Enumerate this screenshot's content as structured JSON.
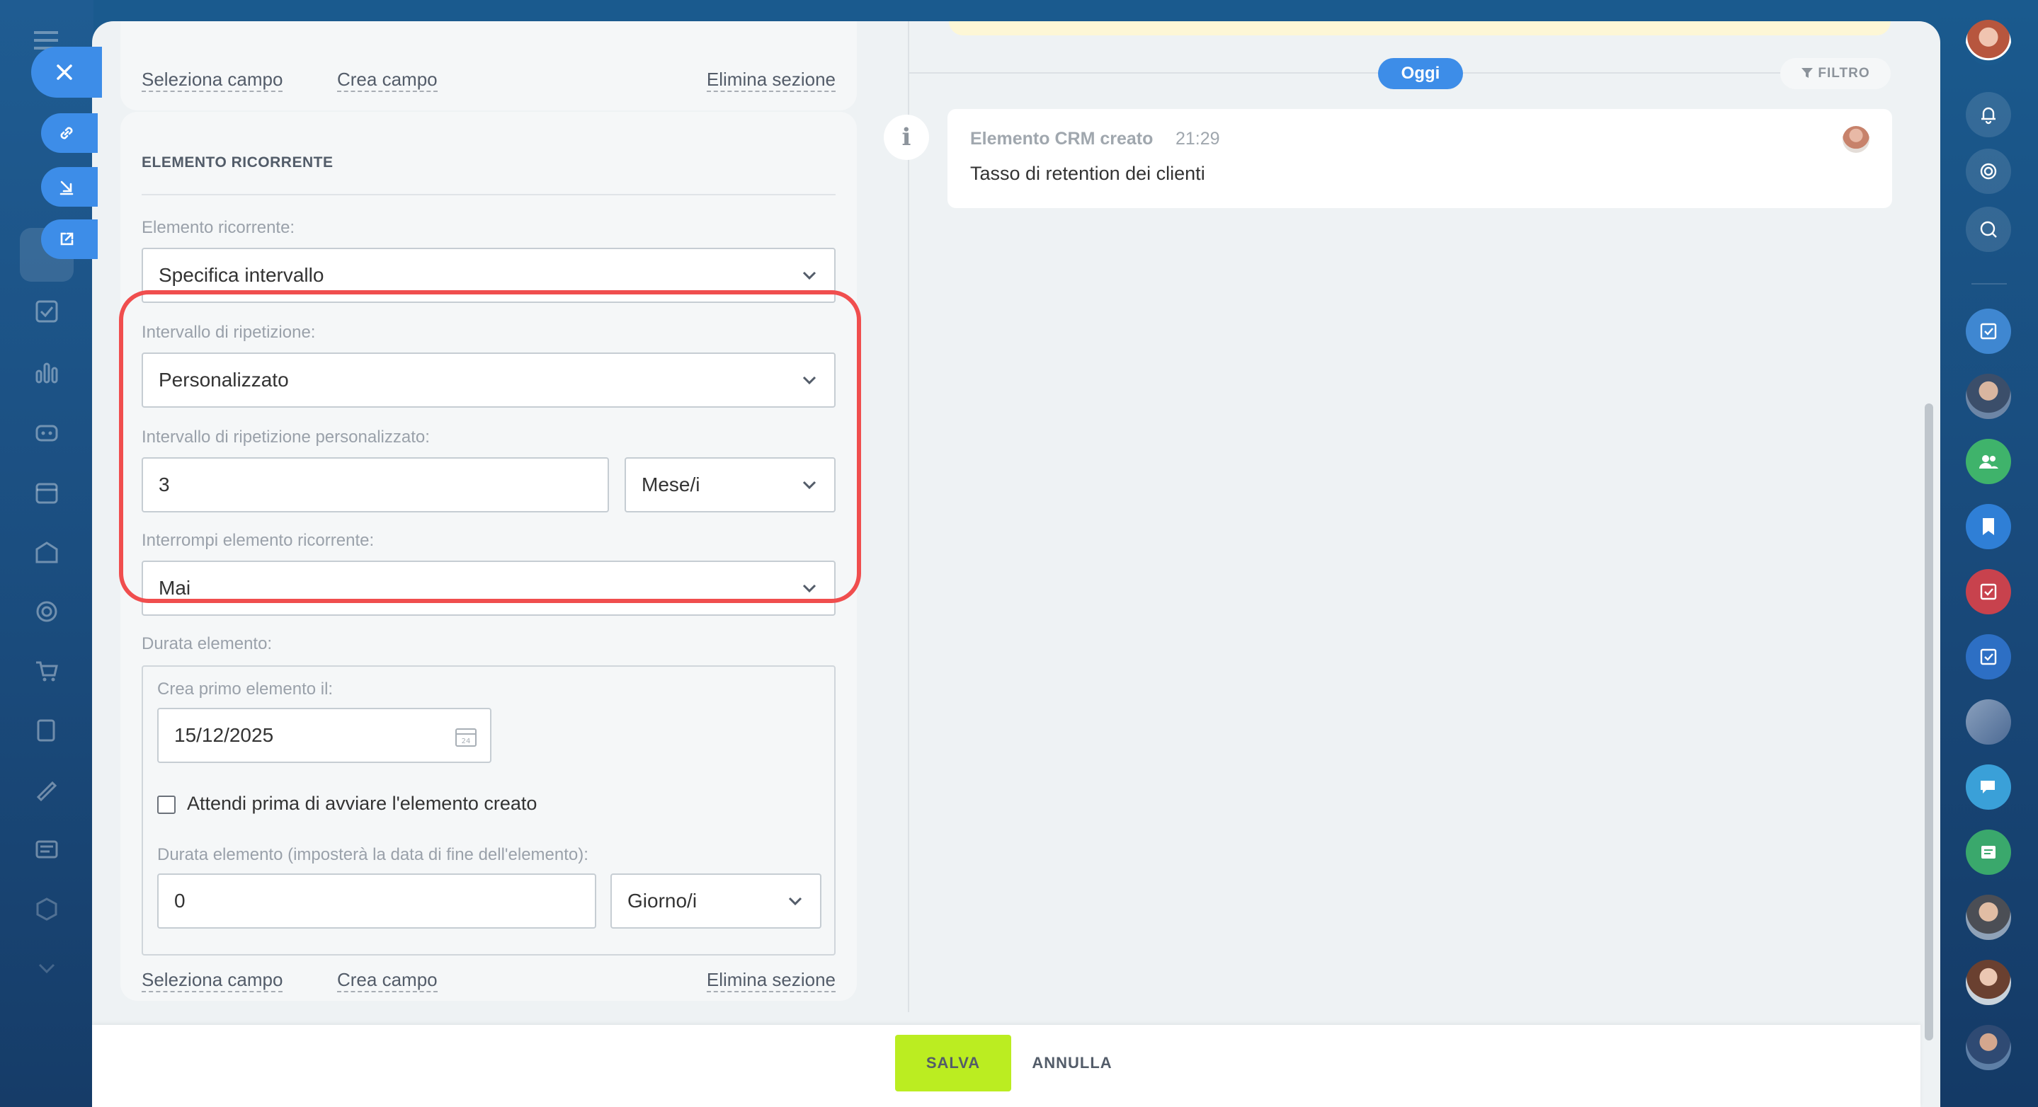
{
  "top_card": {
    "select_field": "Seleziona campo",
    "create_field": "Crea campo",
    "delete_section": "Elimina sezione"
  },
  "section": {
    "title": "ELEMENTO RICORRENTE",
    "recurring_label": "Elemento ricorrente:",
    "recurring_value": "Specifica intervallo",
    "repeat_interval_label": "Intervallo di ripetizione:",
    "repeat_interval_value": "Personalizzato",
    "custom_interval_label": "Intervallo di ripetizione personalizzato:",
    "custom_interval_number": "3",
    "custom_interval_unit": "Mese/i",
    "stop_label": "Interrompi elemento ricorrente:",
    "stop_value": "Mai",
    "duration_label": "Durata elemento:",
    "first_create_label": "Crea primo elemento il:",
    "first_create_date": "15/12/2025",
    "wait_checkbox_label": "Attendi prima di avviare l'elemento creato",
    "wait_checked": false,
    "item_duration_label": "Durata elemento (imposterà la data di fine dell'elemento):",
    "item_duration_number": "0",
    "item_duration_unit": "Giorno/i",
    "select_field": "Seleziona campo",
    "create_field": "Crea campo",
    "delete_section": "Elimina sezione"
  },
  "timeline": {
    "today_badge": "Oggi",
    "filter_label": "FILTRO",
    "event": {
      "title": "Elemento CRM creato",
      "time": "21:29",
      "text": "Tasso di retention dei clienti"
    }
  },
  "footer": {
    "save_label": "SALVA",
    "cancel_label": "ANNULLA"
  },
  "colors": {
    "accent_blue": "#3d8de8",
    "save_green": "#bbed21",
    "highlight_red": "#f04e4e"
  }
}
